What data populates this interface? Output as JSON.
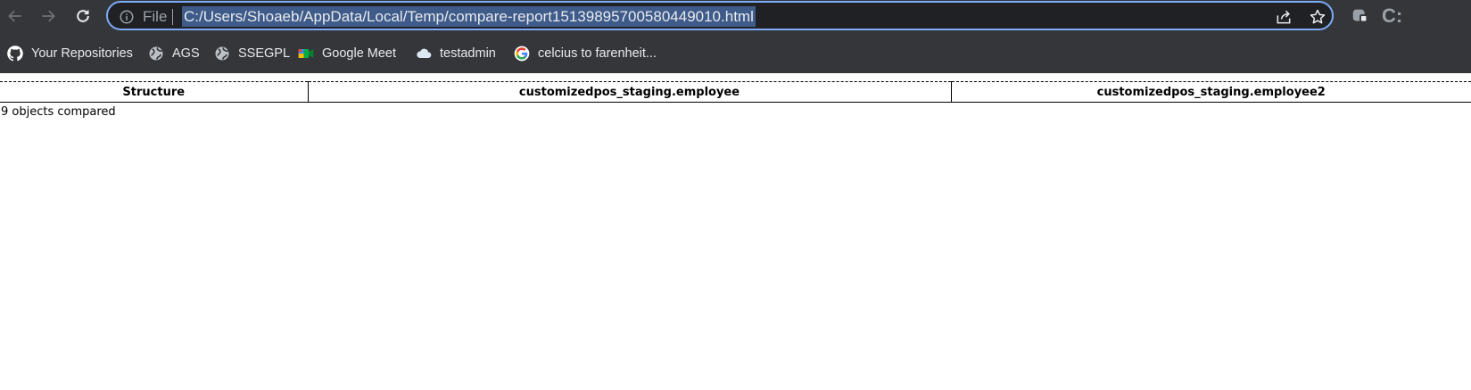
{
  "browser": {
    "omnibox": {
      "scheme_label": "File",
      "url": "C:/Users/Shoaeb/AppData/Local/Temp/compare-report15139895700580449010.html"
    },
    "profile_initials": "C:",
    "bookmarks": [
      {
        "label": "Your Repositories",
        "icon": "github-icon"
      },
      {
        "label": "AGS",
        "icon": "globe-icon"
      },
      {
        "label": "SSEGPL",
        "icon": "globe-icon"
      },
      {
        "label": "Google Meet",
        "icon": "google-meet-icon"
      },
      {
        "label": "testadmin",
        "icon": "cloud-icon"
      },
      {
        "label": "celcius to farenheit...",
        "icon": "google-icon"
      }
    ]
  },
  "report": {
    "columns": [
      "Structure",
      "customizedpos_staging.employee",
      "customizedpos_staging.employee2"
    ],
    "summary": "9 objects compared"
  },
  "colors": {
    "chrome_bg": "#35363a",
    "omnibox_bg": "#202124",
    "omnibox_focus": "#7cacf8",
    "url_selection": "#3e5b8a",
    "page_bg": "#ffffff"
  }
}
